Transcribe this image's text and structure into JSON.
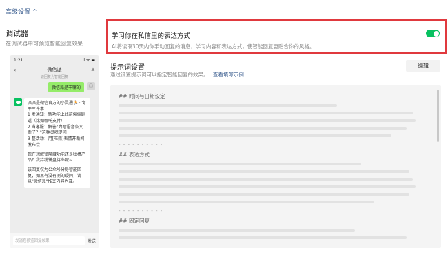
{
  "advanced_header": "高级设置",
  "debugger": {
    "title": "调试器",
    "subtitle": "在调试器中可预览智能回复效果"
  },
  "phone": {
    "status_time": "1:21",
    "status_icons": "..ıl ᯤ ▬",
    "chat_name": "微信派",
    "chat_subnote": "该回复为智能回复",
    "user_message": "微信派是干嘛的",
    "reply_paragraphs": [
      "派派是微信官方的小灵通🏃~专干三件事：\n1 发通知：新功能上线前偷偷剧透（比如哪吒支付）\n2 当客服：解答\"为啥语音条又断了？\"这种灵魂提问\n3 整活动：用[旺柴]表情开新闻发布会",
      "现在想解锁隐藏功能还是吐槽产品？我持粉镜盘待命呢~",
      "该回复仅为公众号分身智能回复，如果有没有测的疑问，请以\"微信派\"推文内容为准。"
    ],
    "input_placeholder": "发消息预览回复效果",
    "send_label": "发送"
  },
  "learn_style": {
    "title": "学习你在私信里的表达方式",
    "description": "AI将读取30天内你手动回复的消息，学习内容和表达方式，使智能回复更贴合你的风格。",
    "enabled": true
  },
  "prompt": {
    "title": "提示词设置",
    "subtitle": "通过设置提示词可以指定智能回复的效果。",
    "example_link": "查看填写示例",
    "edit_label": "编辑",
    "sections": [
      {
        "heading": "## 时间与日期设定",
        "lines": [
          0.72,
          0.97,
          0.98,
          0.95,
          0.9
        ]
      },
      {
        "heading": "## 表达方式",
        "lines": [
          0.8,
          0.96,
          0.97,
          0.98,
          0.96,
          0.84
        ]
      },
      {
        "heading": "## 固定回复",
        "lines": [
          0.78,
          0.95
        ]
      }
    ],
    "divider": "- - - - - - - - - -"
  },
  "colors": {
    "accent_green": "#07c160",
    "highlight_red": "#e0393e",
    "link_blue": "#3a5d8f"
  }
}
